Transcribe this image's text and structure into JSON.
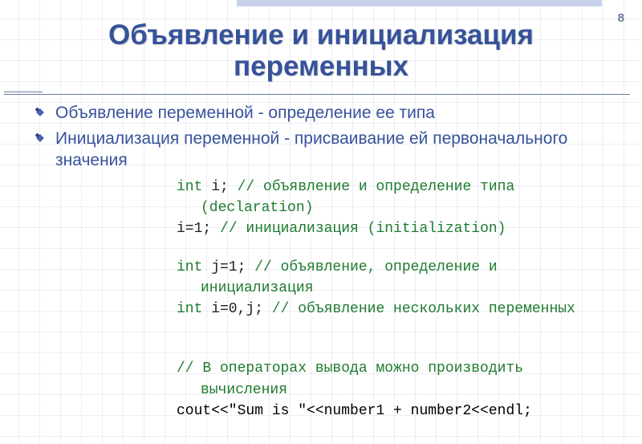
{
  "page_number": "8",
  "title_line1": "Объявление и инициализация",
  "title_line2": "переменных",
  "bullets": [
    "Объявление переменной - определение ее типа",
    "Инициализация переменной - присваивание ей первоначального значения"
  ],
  "code": {
    "kw_int": "int",
    "l1_code": " i; ",
    "l1_cm": "// объявление и определение типа",
    "l1b_cm": "(declaration)",
    "l2_code": "i=1;   ",
    "l2_cm": "// инициализация (initialization)",
    "l3_code": " j=1; ",
    "l3_cm": "// объявление, определение и",
    "l3b_cm": "инициализация",
    "l4_code": " i=0,j; ",
    "l4_cm": "// объявление нескольких переменных",
    "l5_cm": "// В операторах вывода можно производить",
    "l5b_cm": "вычисления",
    "l6_code": "cout<<\"Sum is \"<<number1 + number2<<endl;"
  }
}
